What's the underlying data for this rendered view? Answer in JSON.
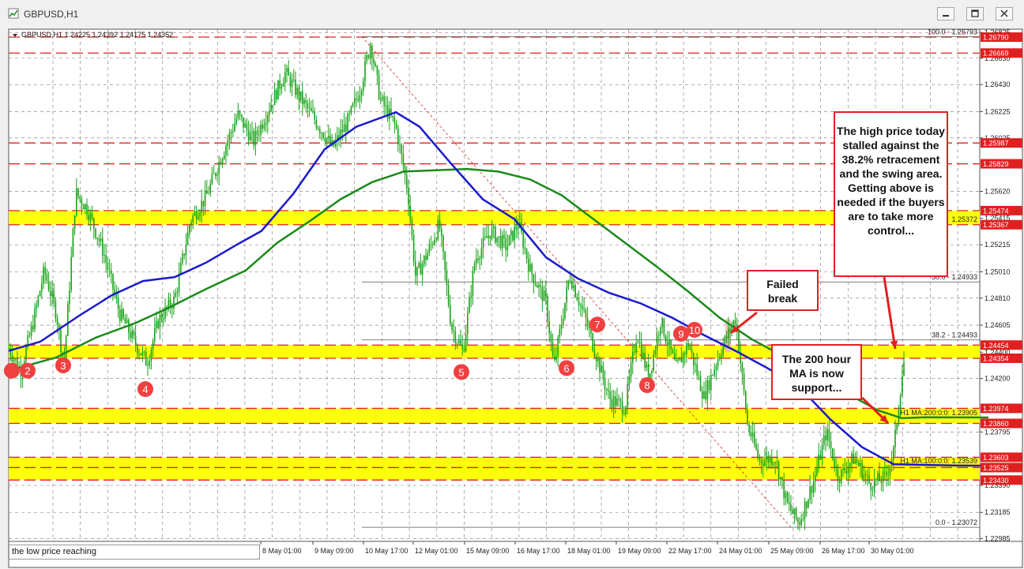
{
  "window": {
    "title": "GBPUSD,H1",
    "minimize_icon": "minimize-icon",
    "restore_icon": "restore-icon",
    "close_icon": "close-icon"
  },
  "chart_data": {
    "type": "candlestick",
    "symbol_header": "GBPUSD,H1  1.24225 1.24392 1.24175 1.24352",
    "ylim": [
      1.22965,
      1.2685
    ],
    "price_ticks": [
      "1.26825",
      "1.26630",
      "1.26430",
      "1.26225",
      "1.26025",
      "1.25620",
      "1.25415",
      "1.25215",
      "1.25010",
      "1.24810",
      "1.24605",
      "1.24400",
      "1.24200",
      "1.23795",
      "1.23590",
      "1.23390",
      "1.23185",
      "1.22985"
    ],
    "x_labels": [
      "8 May 01:00",
      "9 May 09:00",
      "10 May 17:00",
      "12 May 01:00",
      "15 May 09:00",
      "16 May 17:00",
      "18 May 01:00",
      "19 May 09:00",
      "22 May 17:00",
      "24 May 01:00",
      "25 May 09:00",
      "26 May 17:00",
      "30 May 01:00"
    ],
    "horizontal_levels": [
      {
        "price": 1.2679,
        "label": "1.26790",
        "style": "red-dashed"
      },
      {
        "price": 1.26669,
        "label": "1.26669",
        "style": "red-dashed"
      },
      {
        "price": 1.25987,
        "label": "1.25987",
        "style": "red-dashed"
      },
      {
        "price": 1.25829,
        "label": "1.25829",
        "style": "red-dashed"
      },
      {
        "price": 1.25474,
        "label": "1.25474",
        "style": "red-dashed"
      },
      {
        "price": 1.25367,
        "label": "1.25367",
        "style": "red-dashed"
      },
      {
        "price": 1.24454,
        "label": "1.24454",
        "style": "red-dashed"
      },
      {
        "price": 1.24354,
        "label": "1.24354",
        "style": "red-dashed"
      },
      {
        "price": 1.23974,
        "label": "1.23974",
        "style": "red-dashed"
      },
      {
        "price": 1.2386,
        "label": "1.23860",
        "style": "red-dashed"
      },
      {
        "price": 1.23603,
        "label": "1.23603",
        "style": "red-dashed"
      },
      {
        "price": 1.23525,
        "label": "1.23525",
        "style": "red-dashed"
      },
      {
        "price": 1.2343,
        "label": "1.23430",
        "style": "red-dashed"
      }
    ],
    "yellow_zones": [
      [
        1.25367,
        1.25474
      ],
      [
        1.24354,
        1.24454
      ],
      [
        1.2386,
        1.23974
      ],
      [
        1.2343,
        1.23603
      ]
    ],
    "fibonacci": [
      {
        "label": "100.0 - 1.26793",
        "price": 1.26793
      },
      {
        "label": "50.0 - 1.24933",
        "price": 1.24933
      },
      {
        "label": "38.2 - 1.24493",
        "price": 1.24493
      },
      {
        "label": "0.0 - 1.23072",
        "price": 1.23072
      }
    ],
    "ma_labels": [
      {
        "label": "H1 MA:200:0:0: 1.23905",
        "price": 1.23905
      },
      {
        "label": "H1 MA:100:0:0: 1.23539",
        "price": 1.23539
      }
    ],
    "ma_tags": [
      {
        "label": "1.25372",
        "price": 1.25372
      }
    ],
    "ma100_path": [
      [
        0,
        1.2441
      ],
      [
        40,
        1.2448
      ],
      [
        90,
        1.2468
      ],
      [
        130,
        1.2483
      ],
      [
        170,
        1.2494
      ],
      [
        210,
        1.2497
      ],
      [
        250,
        1.2508
      ],
      [
        290,
        1.2522
      ],
      [
        320,
        1.2532
      ],
      [
        360,
        1.256
      ],
      [
        400,
        1.2594
      ],
      [
        440,
        1.2611
      ],
      [
        490,
        1.2622
      ],
      [
        520,
        1.2611
      ],
      [
        560,
        1.2583
      ],
      [
        600,
        1.2556
      ],
      [
        640,
        1.2541
      ],
      [
        680,
        1.2512
      ],
      [
        720,
        1.2496
      ],
      [
        760,
        1.2485
      ],
      [
        800,
        1.2477
      ],
      [
        840,
        1.2466
      ],
      [
        880,
        1.2453
      ],
      [
        920,
        1.2441
      ],
      [
        960,
        1.2428
      ],
      [
        1000,
        1.2414
      ],
      [
        1040,
        1.2389
      ],
      [
        1080,
        1.2368
      ],
      [
        1120,
        1.2355
      ],
      [
        1160,
        1.23545
      ],
      [
        1200,
        1.2354
      ],
      [
        1240,
        1.23539
      ]
    ],
    "ma200_path": [
      [
        0,
        1.2426
      ],
      [
        60,
        1.2436
      ],
      [
        110,
        1.2451
      ],
      [
        160,
        1.2462
      ],
      [
        200,
        1.2473
      ],
      [
        250,
        1.2488
      ],
      [
        300,
        1.2502
      ],
      [
        340,
        1.2523
      ],
      [
        380,
        1.2539
      ],
      [
        420,
        1.2556
      ],
      [
        460,
        1.2569
      ],
      [
        500,
        1.2577
      ],
      [
        540,
        1.2578
      ],
      [
        580,
        1.2579
      ],
      [
        620,
        1.2577
      ],
      [
        660,
        1.2571
      ],
      [
        700,
        1.2559
      ],
      [
        740,
        1.2541
      ],
      [
        780,
        1.2523
      ],
      [
        820,
        1.2505
      ],
      [
        860,
        1.2486
      ],
      [
        900,
        1.2466
      ],
      [
        940,
        1.245
      ],
      [
        980,
        1.2437
      ],
      [
        1020,
        1.2422
      ],
      [
        1060,
        1.2409
      ],
      [
        1100,
        1.2396
      ],
      [
        1130,
        1.239
      ],
      [
        1160,
        1.23906
      ],
      [
        1240,
        1.23905
      ]
    ],
    "swing_markers": [
      {
        "label": "2",
        "x": 24,
        "price": 1.2426
      },
      {
        "label": "3",
        "x": 69,
        "price": 1.243
      },
      {
        "label": "4",
        "x": 173,
        "price": 1.2412
      },
      {
        "label": "5",
        "x": 573,
        "price": 1.2425
      },
      {
        "label": "6",
        "x": 706,
        "price": 1.2428
      },
      {
        "label": "7",
        "x": 745,
        "price": 1.2461
      },
      {
        "label": "8",
        "x": 808,
        "price": 1.2415
      },
      {
        "label": "9",
        "x": 851,
        "price": 1.2454
      },
      {
        "label": "10",
        "x": 868,
        "price": 1.2457
      }
    ],
    "price_path": [
      [
        0,
        1.2443
      ],
      [
        15,
        1.2426
      ],
      [
        30,
        1.246
      ],
      [
        45,
        1.2502
      ],
      [
        60,
        1.247
      ],
      [
        70,
        1.243
      ],
      [
        85,
        1.2561
      ],
      [
        100,
        1.2548
      ],
      [
        120,
        1.2516
      ],
      [
        140,
        1.247
      ],
      [
        160,
        1.2447
      ],
      [
        175,
        1.2432
      ],
      [
        190,
        1.2465
      ],
      [
        210,
        1.248
      ],
      [
        230,
        1.254
      ],
      [
        250,
        1.2558
      ],
      [
        270,
        1.259
      ],
      [
        290,
        1.262
      ],
      [
        310,
        1.26
      ],
      [
        330,
        1.2626
      ],
      [
        350,
        1.2652
      ],
      [
        370,
        1.2632
      ],
      [
        390,
        1.2614
      ],
      [
        410,
        1.2595
      ],
      [
        430,
        1.2616
      ],
      [
        445,
        1.264
      ],
      [
        458,
        1.2675
      ],
      [
        470,
        1.2632
      ],
      [
        490,
        1.2611
      ],
      [
        505,
        1.2563
      ],
      [
        515,
        1.2497
      ],
      [
        530,
        1.2515
      ],
      [
        545,
        1.2537
      ],
      [
        560,
        1.246
      ],
      [
        575,
        1.244
      ],
      [
        590,
        1.251
      ],
      [
        610,
        1.2532
      ],
      [
        630,
        1.252
      ],
      [
        645,
        1.2538
      ],
      [
        660,
        1.2502
      ],
      [
        680,
        1.2478
      ],
      [
        690,
        1.2428
      ],
      [
        710,
        1.2499
      ],
      [
        730,
        1.2465
      ],
      [
        745,
        1.2435
      ],
      [
        760,
        1.2405
      ],
      [
        780,
        1.2398
      ],
      [
        795,
        1.2455
      ],
      [
        810,
        1.242
      ],
      [
        825,
        1.2464
      ],
      [
        845,
        1.2427
      ],
      [
        860,
        1.2447
      ],
      [
        880,
        1.2406
      ],
      [
        900,
        1.244
      ],
      [
        920,
        1.2466
      ],
      [
        935,
        1.2385
      ],
      [
        950,
        1.2358
      ],
      [
        970,
        1.236
      ],
      [
        985,
        1.2325
      ],
      [
        1000,
        1.231
      ],
      [
        1020,
        1.2345
      ],
      [
        1035,
        1.238
      ],
      [
        1050,
        1.2345
      ],
      [
        1070,
        1.236
      ],
      [
        1090,
        1.234
      ],
      [
        1110,
        1.2345
      ],
      [
        1120,
        1.2365
      ],
      [
        1130,
        1.242
      ],
      [
        1135,
        1.244
      ]
    ]
  },
  "annotations": {
    "swing_note": "The high price today stalled against the 38.2% retracement and the swing area. Getting above is needed if the buyers are to take more control...",
    "failed_break": "Failed break",
    "ma_support": "The 200 hour MA is now support...",
    "footer_note": "the low price reaching"
  },
  "colors": {
    "ma100": "#1a1acc",
    "ma200": "#1a8a1a",
    "candle": "#17a317",
    "zone": "#ffff00",
    "level": "#e02020",
    "marker": "#f04040"
  }
}
